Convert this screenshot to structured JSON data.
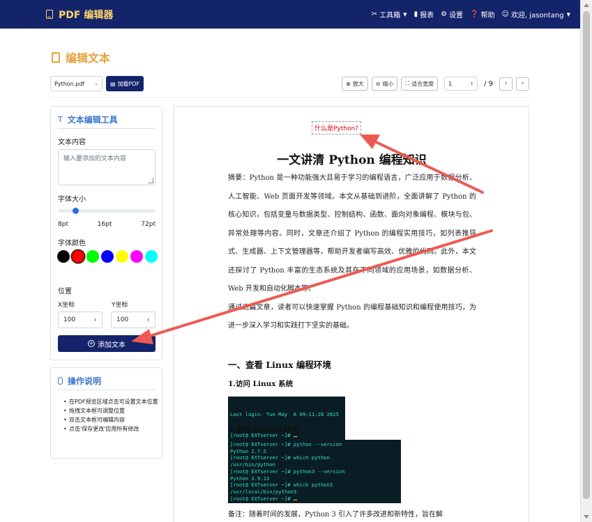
{
  "navbar": {
    "brand": "PDF 编辑器",
    "items": [
      {
        "label": "工具箱",
        "icon": "tools-icon",
        "dropdown": true
      },
      {
        "label": "报表",
        "icon": "bar-chart-icon",
        "dropdown": false
      },
      {
        "label": "设置",
        "icon": "gear-icon",
        "dropdown": false
      },
      {
        "label": "帮助",
        "icon": "question-icon",
        "dropdown": false
      },
      {
        "label": "欢迎, jasontang",
        "icon": "user-icon",
        "dropdown": true
      }
    ]
  },
  "page": {
    "title": "编辑文本"
  },
  "toolbar": {
    "file_value": "Python.pdf",
    "load_label": "加载PDF",
    "zoom_in": "放大",
    "zoom_out": "缩小",
    "fit_width": "适合宽度",
    "page_value": "1",
    "page_total": "/ 9"
  },
  "tools_panel": {
    "title": "文本编辑工具",
    "content_label": "文本内容",
    "content_placeholder": "输入要添加的文本内容",
    "font_size_label": "字体大小",
    "font_size_value": 16,
    "font_size_min": 8,
    "font_size_max": 72,
    "ticks": [
      "8pt",
      "16pt",
      "72pt"
    ],
    "color_label": "字体颜色",
    "colors": [
      "#000000",
      "#ff0000",
      "#00ff00",
      "#0000ff",
      "#ffff00",
      "#ff00ff",
      "#00ffff"
    ],
    "selected_color": "#ff0000",
    "position_label": "位置",
    "x_label": "X坐标",
    "y_label": "Y坐标",
    "x_value": "100",
    "y_value": "100",
    "add_button": "添加文本"
  },
  "help_panel": {
    "title": "操作说明",
    "items": [
      "在PDF预览区域点击可设置文本位置",
      "拖拽文本框可调整位置",
      "双击文本框可编辑内容",
      "点击'保存更改'应用所有修改"
    ]
  },
  "preview": {
    "overlay_text": "什么是Python?",
    "doc_title": "一文讲清 Python 编程知识",
    "paragraphs": [
      "摘要：Python 是一种功能强大且易于学习的编程语言，广泛应用于数据分析、人工智能、Web 页面开发等领域。本文从基础到进阶，全面讲解了 Python 的核心知识，包括变量与数据类型、控制结构、函数、面向对象编程、模块与包、异常处理等内容。同时，文章还介绍了 Python 的编程实用技巧，如列表推导式、生成器、上下文管理器等，帮助开发者编写高效、优雅的代码。此外，本文还探讨了 Python 丰富的生态系统及其在不同领域的应用场景，如数据分析、Web 开发和自动化脚本等。",
      "通过这篇文章，读者可以快速掌握 Python 的编程基础知识和编程使用技巧，为进一步深入学习和实践打下坚实的基础。"
    ],
    "section1": "一、查看 Linux 编程环境",
    "sub1": "1.访问 Linux 系统",
    "term1": [
      "Last login: Tue May  6 09:11:28 2025",
      "[root@ EXTserver ~]# "
    ],
    "sub2": "2.查看 Python 环境",
    "term2": [
      "[root@ EXTserver ~]# python --version",
      "Python 2.7.5",
      "[root@ EXTserver ~]# which python",
      "/usr/bin/python",
      "[root@ EXTserver ~]# python3 --version",
      "Python 3.9.13",
      "[root@ EXTserver ~]# which python3",
      "/usr/local/bin/python3",
      "[root@ EXTserver ~]# "
    ],
    "note": "备注：随着时间的发展，Python 3 引入了许多改进和新特性，旨在解"
  },
  "colors": {
    "navbar": "#14246b",
    "brand": "#ffd56a",
    "title": "#e6a23c",
    "panel_title": "#3a78c8",
    "arrow": "#ee5a52"
  }
}
